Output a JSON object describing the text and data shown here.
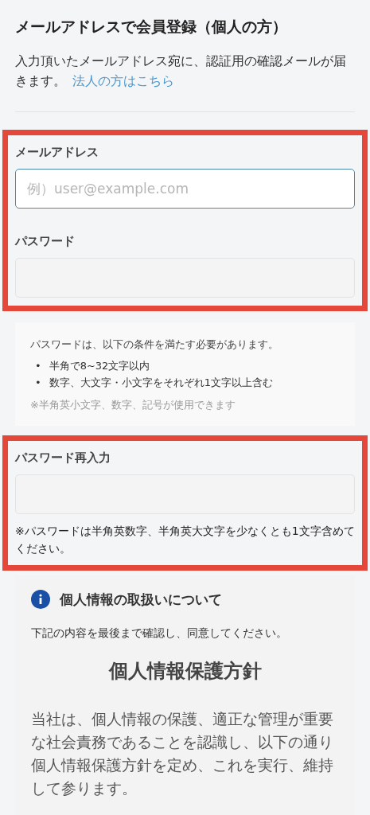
{
  "title": "メールアドレスで会員登録（個人の方）",
  "intro": {
    "text": "入力頂いたメールアドレス宛に、認証用の確認メールが届きます。",
    "link": "法人の方はこちら"
  },
  "account_group": {
    "highlighted": true,
    "fields": [
      {
        "label": "メールアドレス",
        "placeholder": "例）user@example.com",
        "focused": true
      },
      {
        "label": "パスワード",
        "focused": false
      }
    ]
  },
  "password_rules": {
    "intro": "パスワードは、以下の条件を満たす必要があります。",
    "items": [
      {
        "bullet": "•",
        "text": "半角で8~32文字以内"
      },
      {
        "bullet": "•",
        "text": "数字、大文字・小文字をそれぞれ1文字以上含む"
      }
    ],
    "note": "※半角英小文字、数字、記号が使用できます"
  },
  "confirm_group": {
    "highlighted": true,
    "field": {
      "label": "パスワード再入力",
      "focused": false
    },
    "note": "※パスワードは半角英数字、半角英大文字を少なくとも1文字含めてください。"
  },
  "privacy": {
    "heading": "個人情報の取扱いについて",
    "instruction": "下記の内容を最後まで確認し、同意してください。",
    "policy_title": "個人情報保護方針",
    "policy_text": "当社は、個人情報の保護、適正な管理が重要な社会責務であることを認識し、以下の通り個人情報保護方針を定め、これを実行、維持して参ります。"
  }
}
